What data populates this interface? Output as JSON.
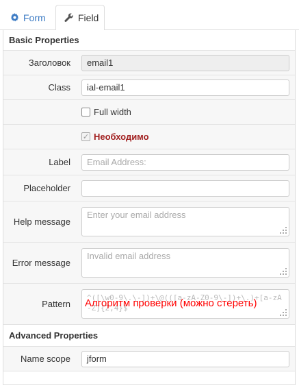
{
  "tabs": [
    {
      "label": "Form",
      "icon": "gear-icon",
      "active": false
    },
    {
      "label": "Field",
      "icon": "wrench-icon",
      "active": true
    }
  ],
  "colors": {
    "accent": "#3c7bc4",
    "required": "#a11f1f",
    "note": "#ff0000"
  },
  "basic": {
    "title": "Basic Properties",
    "heading": {
      "label": "Заголовок",
      "value": "email1"
    },
    "class": {
      "label": "Class",
      "value": "ial-email1"
    },
    "full_width": {
      "label": "Full width",
      "checked": false
    },
    "required": {
      "label": "Необходимо",
      "checked": true
    },
    "field_label": {
      "label": "Label",
      "placeholder": "Email Address:"
    },
    "placeholder": {
      "label": "Placeholder",
      "value": ""
    },
    "help": {
      "label": "Help message",
      "placeholder": "Enter your email address"
    },
    "error": {
      "label": "Error message",
      "placeholder": "Invalid email address"
    },
    "pattern": {
      "label": "Pattern",
      "placeholder": "^([\\w0-9\\.\\-])+\\@(([a-zA-Z0-9\\-])+\\.)+[a-zA-Z]{2,4}$",
      "note": "Алгоритм проверки (можно стереть)"
    }
  },
  "advanced": {
    "title": "Advanced Properties",
    "name_scope": {
      "label": "Name scope",
      "value": "jform"
    }
  }
}
